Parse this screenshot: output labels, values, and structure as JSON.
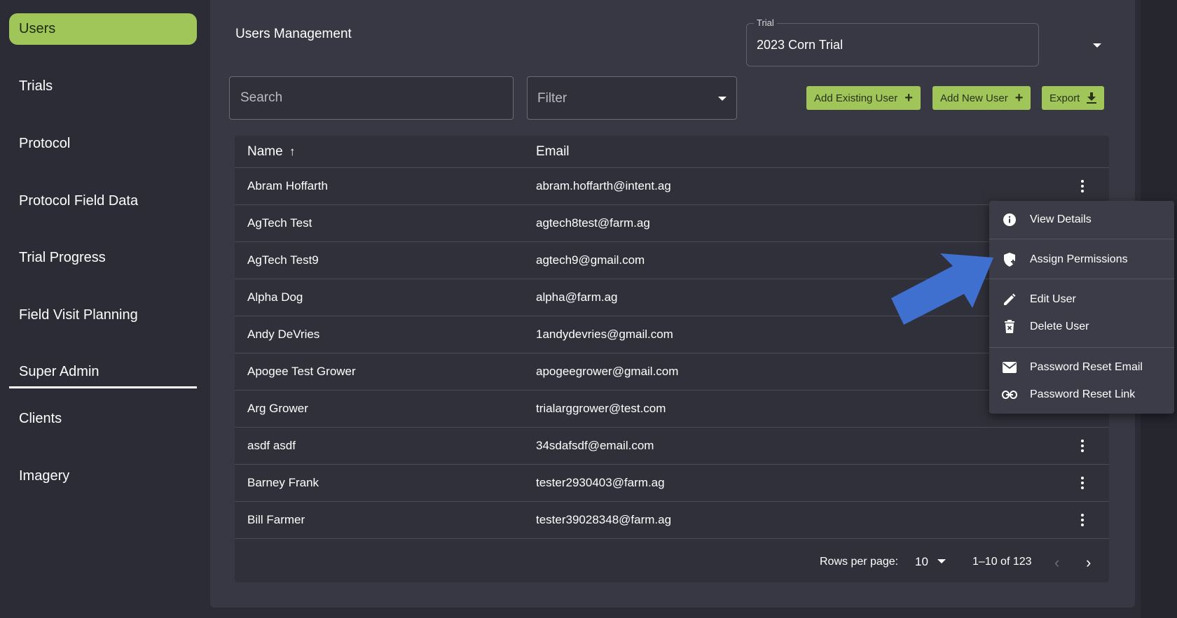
{
  "sidebar": {
    "items": [
      {
        "label": "Users",
        "active": true
      },
      {
        "label": "Trials"
      },
      {
        "label": "Protocol"
      },
      {
        "label": "Protocol Field Data"
      },
      {
        "label": "Trial Progress"
      },
      {
        "label": "Field Visit Planning"
      },
      {
        "label": "Super Admin",
        "underlined": true
      },
      {
        "label": "Clients"
      },
      {
        "label": "Imagery"
      }
    ]
  },
  "header": {
    "title": "Users Management",
    "trial_legend": "Trial",
    "trial_value": "2023 Corn Trial"
  },
  "toolbar": {
    "search_placeholder": "Search",
    "filter_label": "Filter",
    "add_existing_label": "Add Existing User",
    "add_new_label": "Add New User",
    "export_label": "Export"
  },
  "table": {
    "col_name": "Name",
    "col_email": "Email",
    "rows": [
      {
        "name": "Abram Hoffarth",
        "email": "abram.hoffarth@intent.ag"
      },
      {
        "name": "AgTech Test",
        "email": "agtech8test@farm.ag"
      },
      {
        "name": "AgTech Test9",
        "email": "agtech9@gmail.com"
      },
      {
        "name": "Alpha Dog",
        "email": "alpha@farm.ag"
      },
      {
        "name": "Andy DeVries",
        "email": "1andydevries@gmail.com"
      },
      {
        "name": "Apogee Test Grower",
        "email": "apogeegrower@gmail.com"
      },
      {
        "name": "Arg Grower",
        "email": "trialarggrower@test.com"
      },
      {
        "name": "asdf asdf",
        "email": "34sdafsdf@email.com"
      },
      {
        "name": "Barney Frank",
        "email": "tester2930403@farm.ag"
      },
      {
        "name": "Bill Farmer",
        "email": "tester39028348@farm.ag"
      }
    ]
  },
  "pagination": {
    "rows_per_page_label": "Rows per page:",
    "rows_per_page": "10",
    "range": "1–10 of 123"
  },
  "menu": {
    "view_details": "View Details",
    "assign_permissions": "Assign Permissions",
    "edit_user": "Edit User",
    "delete_user": "Delete User",
    "password_reset_email": "Password Reset Email",
    "password_reset_link": "Password Reset Link"
  },
  "colors": {
    "accent": "#a0c65a",
    "background": "#2b2c35",
    "panel": "#373843",
    "arrow": "#3f6fcf"
  }
}
